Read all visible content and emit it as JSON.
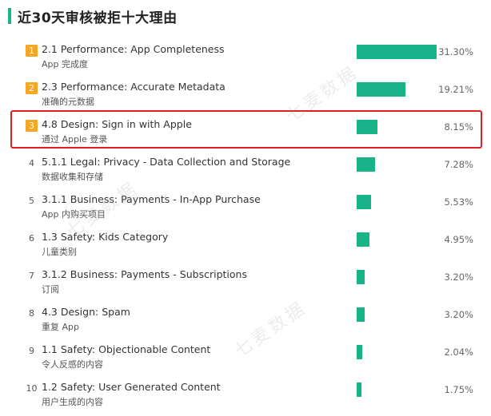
{
  "header": {
    "title": "近30天审核被拒十大理由"
  },
  "watermark": "七麦数据",
  "colors": {
    "bar": "#19b38a",
    "accent": "#1db38a",
    "rank_badge": "#f5a623",
    "highlight_border": "#e02020"
  },
  "chart_data": {
    "type": "bar",
    "orientation": "horizontal",
    "title": "近30天审核被拒十大理由",
    "value_unit": "%",
    "xlim": [
      0,
      31.3
    ],
    "highlighted_rank": 3,
    "categories": [
      "2.1 Performance: App Completeness",
      "2.3 Performance: Accurate Metadata",
      "4.8 Design: Sign in with Apple",
      "5.1.1 Legal: Privacy - Data Collection and Storage",
      "3.1.1 Business: Payments - In-App Purchase",
      "1.3 Safety: Kids Category",
      "3.1.2 Business: Payments - Subscriptions",
      "4.3 Design: Spam",
      "1.1 Safety: Objectionable Content",
      "1.2 Safety: User Generated Content"
    ],
    "subtitles": [
      "App 完成度",
      "准确的元数据",
      "通过 Apple 登录",
      "数据收集和存储",
      "App 内购买项目",
      "儿童类别",
      "订阅",
      "重复 App",
      "令人反感的内容",
      "用户生成的内容"
    ],
    "ranks": [
      "1",
      "2",
      "3",
      "4",
      "5",
      "6",
      "7",
      "8",
      "9",
      "10"
    ],
    "values": [
      31.3,
      19.21,
      8.15,
      7.28,
      5.53,
      4.95,
      3.2,
      3.2,
      2.04,
      1.75
    ],
    "value_labels": [
      "31.30%",
      "19.21%",
      "8.15%",
      "7.28%",
      "5.53%",
      "4.95%",
      "3.20%",
      "3.20%",
      "2.04%",
      "1.75%"
    ]
  }
}
